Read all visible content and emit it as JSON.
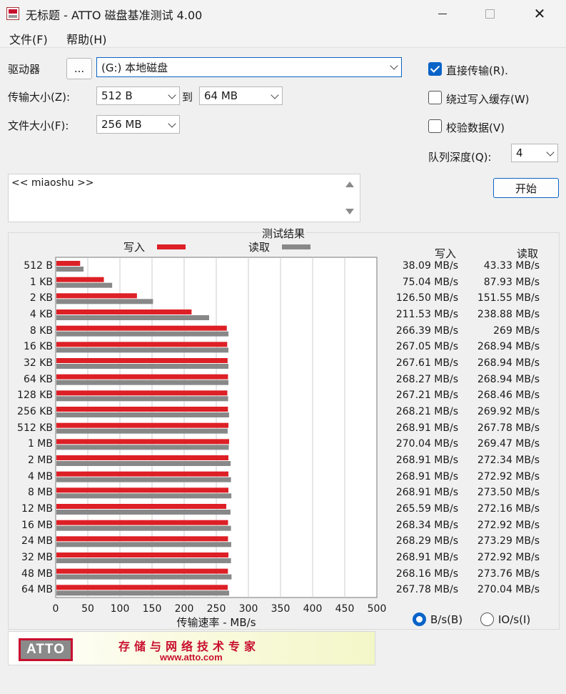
{
  "window": {
    "title": "无标题 - ATTO 磁盘基准测试 4.00",
    "close": "✕"
  },
  "menu": {
    "file": "文件(F)",
    "help": "帮助(H)"
  },
  "form": {
    "drive_label": "驱动器",
    "browse_button": "...",
    "drive_value": "(G:) 本地磁盘",
    "transfer_label": "传输大小(Z):",
    "transfer_from": "512 B",
    "to_label": "到",
    "transfer_to": "64 MB",
    "file_size_label": "文件大小(F):",
    "file_size": "256 MB",
    "direct_io": "直接传输(R).",
    "bypass_cache": "绕过写入缓存(W)",
    "verify": "校验数据(V)",
    "queue_label": "队列深度(Q):",
    "queue_value": "4",
    "start_button": "开始",
    "description": "<< miaoshu >>"
  },
  "results": {
    "title": "测试结果",
    "write_legend": "写入",
    "read_legend": "读取",
    "write_header": "写入",
    "read_header": "读取",
    "units_bytes": "B/s(B)",
    "units_io": "IO/s(I)"
  },
  "colors": {
    "write": "#dd1f26",
    "read": "#888888",
    "accent": "#0a64c8"
  },
  "chart_data": {
    "type": "bar",
    "orientation": "horizontal",
    "xlabel": "传输速率 - MB/s",
    "xlim": [
      0,
      500
    ],
    "xticks": [
      0,
      50,
      100,
      150,
      200,
      250,
      300,
      350,
      400,
      450,
      500
    ],
    "grid": true,
    "categories": [
      "512 B",
      "1 KB",
      "2 KB",
      "4 KB",
      "8 KB",
      "16 KB",
      "32 KB",
      "64 KB",
      "128 KB",
      "256 KB",
      "512 KB",
      "1 MB",
      "2 MB",
      "4 MB",
      "8 MB",
      "12 MB",
      "16 MB",
      "24 MB",
      "32 MB",
      "48 MB",
      "64 MB"
    ],
    "series": [
      {
        "name": "写入",
        "values": [
          38.09,
          75.04,
          126.5,
          211.53,
          266.39,
          267.05,
          267.61,
          268.27,
          267.21,
          268.21,
          268.91,
          270.04,
          268.91,
          268.91,
          268.91,
          265.59,
          268.34,
          268.29,
          268.91,
          268.16,
          267.78
        ]
      },
      {
        "name": "读取",
        "values": [
          43.33,
          87.93,
          151.55,
          238.88,
          269,
          268.94,
          268.94,
          268.94,
          268.46,
          269.92,
          267.78,
          269.47,
          272.34,
          272.92,
          273.5,
          272.16,
          272.92,
          273.29,
          272.92,
          273.76,
          270.04
        ]
      }
    ],
    "write_labels": [
      "38.09 MB/s",
      "75.04 MB/s",
      "126.50 MB/s",
      "211.53 MB/s",
      "266.39 MB/s",
      "267.05 MB/s",
      "267.61 MB/s",
      "268.27 MB/s",
      "267.21 MB/s",
      "268.21 MB/s",
      "268.91 MB/s",
      "270.04 MB/s",
      "268.91 MB/s",
      "268.91 MB/s",
      "268.91 MB/s",
      "265.59 MB/s",
      "268.34 MB/s",
      "268.29 MB/s",
      "268.91 MB/s",
      "268.16 MB/s",
      "267.78 MB/s"
    ],
    "read_labels": [
      "43.33 MB/s",
      "87.93 MB/s",
      "151.55 MB/s",
      "238.88 MB/s",
      "269 MB/s",
      "268.94 MB/s",
      "268.94 MB/s",
      "268.94 MB/s",
      "268.46 MB/s",
      "269.92 MB/s",
      "267.78 MB/s",
      "269.47 MB/s",
      "272.34 MB/s",
      "272.92 MB/s",
      "273.50 MB/s",
      "272.16 MB/s",
      "272.92 MB/s",
      "273.29 MB/s",
      "272.92 MB/s",
      "273.76 MB/s",
      "270.04 MB/s"
    ]
  },
  "banner": {
    "logo": "ATTO",
    "slogan": "存储与网络技术专家",
    "url": "www.atto.com"
  }
}
